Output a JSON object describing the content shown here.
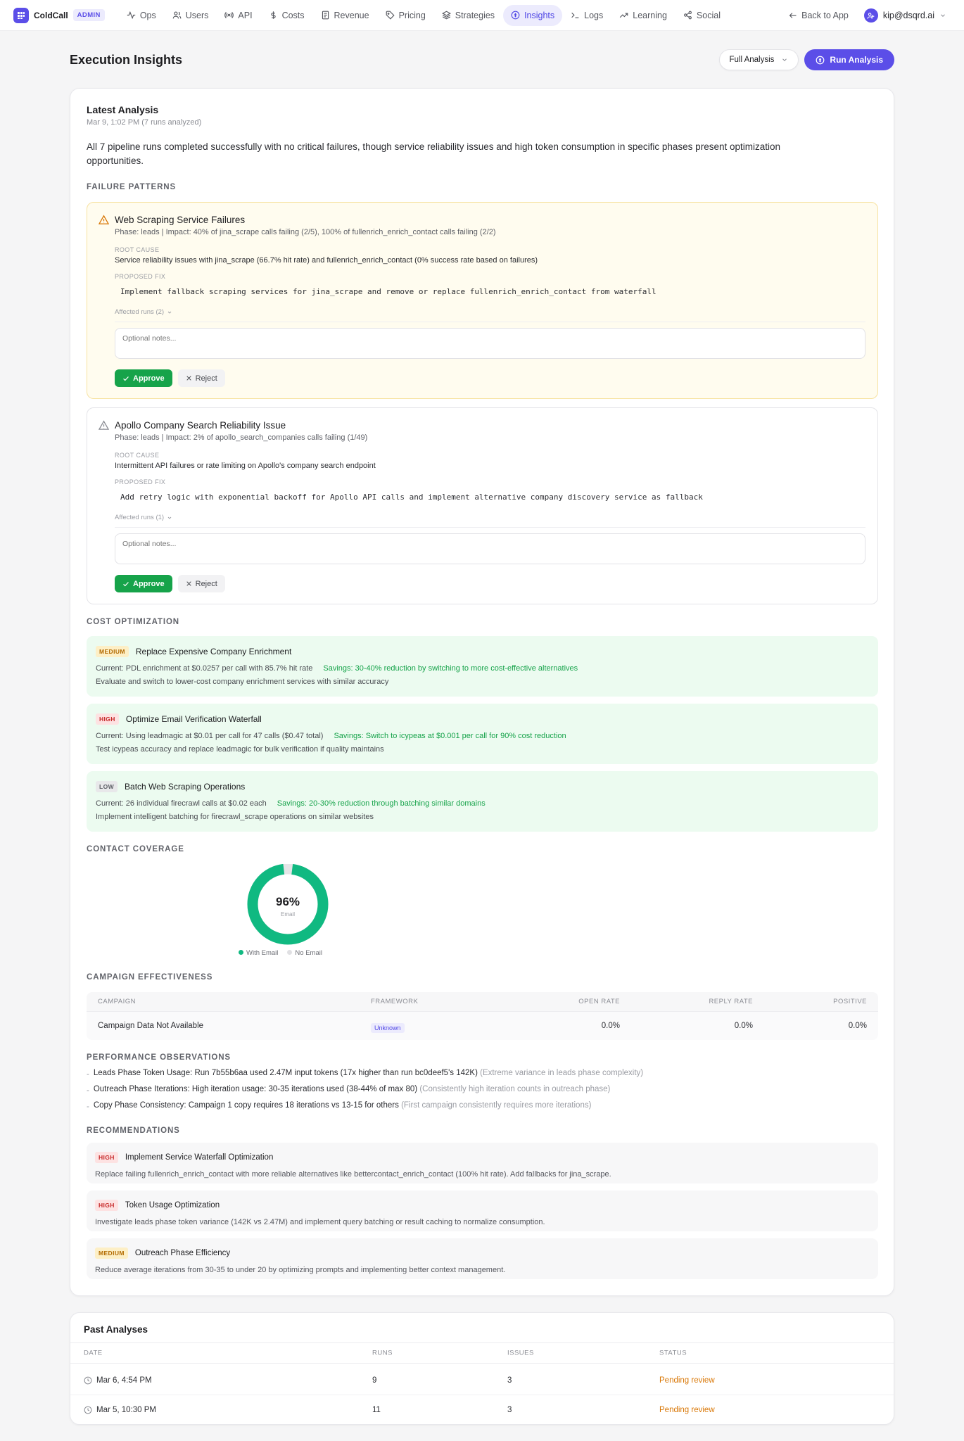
{
  "nav": {
    "brand": "ColdCall",
    "admin_badge": "ADMIN",
    "items": [
      {
        "label": "Ops",
        "icon": "activity-icon"
      },
      {
        "label": "Users",
        "icon": "users-icon"
      },
      {
        "label": "API",
        "icon": "radio-icon"
      },
      {
        "label": "Costs",
        "icon": "dollar-icon"
      },
      {
        "label": "Revenue",
        "icon": "receipt-icon"
      },
      {
        "label": "Pricing",
        "icon": "tag-icon"
      },
      {
        "label": "Strategies",
        "icon": "layers-icon"
      },
      {
        "label": "Insights",
        "icon": "insights-icon",
        "active": true
      },
      {
        "label": "Logs",
        "icon": "terminal-icon"
      },
      {
        "label": "Learning",
        "icon": "trending-up-icon"
      },
      {
        "label": "Social",
        "icon": "share-icon"
      }
    ],
    "back_label": "Back to App",
    "user_email": "kip@dsqrd.ai"
  },
  "page": {
    "title": "Execution Insights",
    "mode_select": "Full Analysis",
    "run_button": "Run Analysis"
  },
  "latest": {
    "title": "Latest Analysis",
    "subtitle": "Mar 9, 1:02 PM (7 runs analyzed)",
    "summary": "All 7 pipeline runs completed successfully with no critical failures, though service reliability issues and high token consumption in specific phases present optimization opportunities."
  },
  "sections": {
    "failure": "FAILURE PATTERNS",
    "cost": "COST OPTIMIZATION",
    "coverage": "CONTACT COVERAGE",
    "campaign": "CAMPAIGN EFFECTIVENESS",
    "performance": "PERFORMANCE OBSERVATIONS",
    "recommendations": "RECOMMENDATIONS"
  },
  "labels": {
    "root_cause": "ROOT CAUSE",
    "proposed_fix": "PROPOSED FIX",
    "notes_placeholder": "Optional notes...",
    "approve": "Approve",
    "reject": "Reject"
  },
  "failures": [
    {
      "title": "Web Scraping Service Failures",
      "meta": "Phase: leads | Impact: 40% of jina_scrape calls failing (2/5), 100% of fullenrich_enrich_contact calls failing (2/2)",
      "root_cause": "Service reliability issues with jina_scrape (66.7% hit rate) and fullenrich_enrich_contact (0% success rate based on failures)",
      "fix": "Implement fallback scraping services for jina_scrape and remove or replace fullenrich_enrich_contact from waterfall",
      "affected": "Affected runs (2)"
    },
    {
      "title": "Apollo Company Search Reliability Issue",
      "meta": "Phase: leads | Impact: 2% of apollo_search_companies calls failing (1/49)",
      "root_cause": "Intermittent API failures or rate limiting on Apollo's company search endpoint",
      "fix": "Add retry logic with exponential backoff for Apollo API calls and implement alternative company discovery service as fallback",
      "affected": "Affected runs (1)"
    }
  ],
  "cost_items": [
    {
      "priority": "MEDIUM",
      "title": "Replace Expensive Company Enrichment",
      "current": "Current: PDL enrichment at $0.0257 per call with 85.7% hit rate",
      "savings": "Savings: 30-40% reduction by switching to more cost-effective alternatives",
      "action": "Evaluate and switch to lower-cost company enrichment services with similar accuracy"
    },
    {
      "priority": "HIGH",
      "title": "Optimize Email Verification Waterfall",
      "current": "Current: Using leadmagic at $0.01 per call for 47 calls ($0.47 total)",
      "savings": "Savings: Switch to icypeas at $0.001 per call for 90% cost reduction",
      "action": "Test icypeas accuracy and replace leadmagic for bulk verification if quality maintains"
    },
    {
      "priority": "LOW",
      "title": "Batch Web Scraping Operations",
      "current": "Current: 26 individual firecrawl calls at $0.02 each",
      "savings": "Savings: 20-30% reduction through batching similar domains",
      "action": "Implement intelligent batching for firecrawl_scrape operations on similar websites"
    }
  ],
  "coverage": {
    "value_label": "96%",
    "sub_label": "Email",
    "legend_with": "With Email",
    "legend_without": "No Email",
    "with_pct": 96,
    "color_with": "#10b981",
    "color_without": "#e5e5e7"
  },
  "campaign_table": {
    "headers": [
      "CAMPAIGN",
      "FRAMEWORK",
      "OPEN RATE",
      "REPLY RATE",
      "POSITIVE"
    ],
    "rows": [
      {
        "campaign": "Campaign Data Not Available",
        "framework": "Unknown",
        "open": "0.0%",
        "reply": "0.0%",
        "positive": "0.0%"
      }
    ]
  },
  "observations": [
    {
      "text": "Leads Phase Token Usage: Run 7b55b6aa used 2.47M input tokens (17x higher than run bc0deef5's 142K)",
      "note": "(Extreme variance in leads phase complexity)"
    },
    {
      "text": "Outreach Phase Iterations: High iteration usage: 30-35 iterations used (38-44% of max 80)",
      "note": "(Consistently high iteration counts in outreach phase)"
    },
    {
      "text": "Copy Phase Consistency: Campaign 1 copy requires 18 iterations vs 13-15 for others",
      "note": "(First campaign consistently requires more iterations)"
    }
  ],
  "recommendations": [
    {
      "priority": "HIGH",
      "title": "Implement Service Waterfall Optimization",
      "desc": "Replace failing fullenrich_enrich_contact with more reliable alternatives like bettercontact_enrich_contact (100% hit rate). Add fallbacks for jina_scrape."
    },
    {
      "priority": "HIGH",
      "title": "Token Usage Optimization",
      "desc": "Investigate leads phase token variance (142K vs 2.47M) and implement query batching or result caching to normalize consumption."
    },
    {
      "priority": "MEDIUM",
      "title": "Outreach Phase Efficiency",
      "desc": "Reduce average iterations from 30-35 to under 20 by optimizing prompts and implementing better context management."
    }
  ],
  "past": {
    "title": "Past Analyses",
    "headers": [
      "DATE",
      "RUNS",
      "ISSUES",
      "STATUS"
    ],
    "rows": [
      {
        "date": "Mar 6, 4:54 PM",
        "runs": "9",
        "issues": "3",
        "status": "Pending review"
      },
      {
        "date": "Mar 5, 10:30 PM",
        "runs": "11",
        "issues": "3",
        "status": "Pending review"
      }
    ]
  }
}
